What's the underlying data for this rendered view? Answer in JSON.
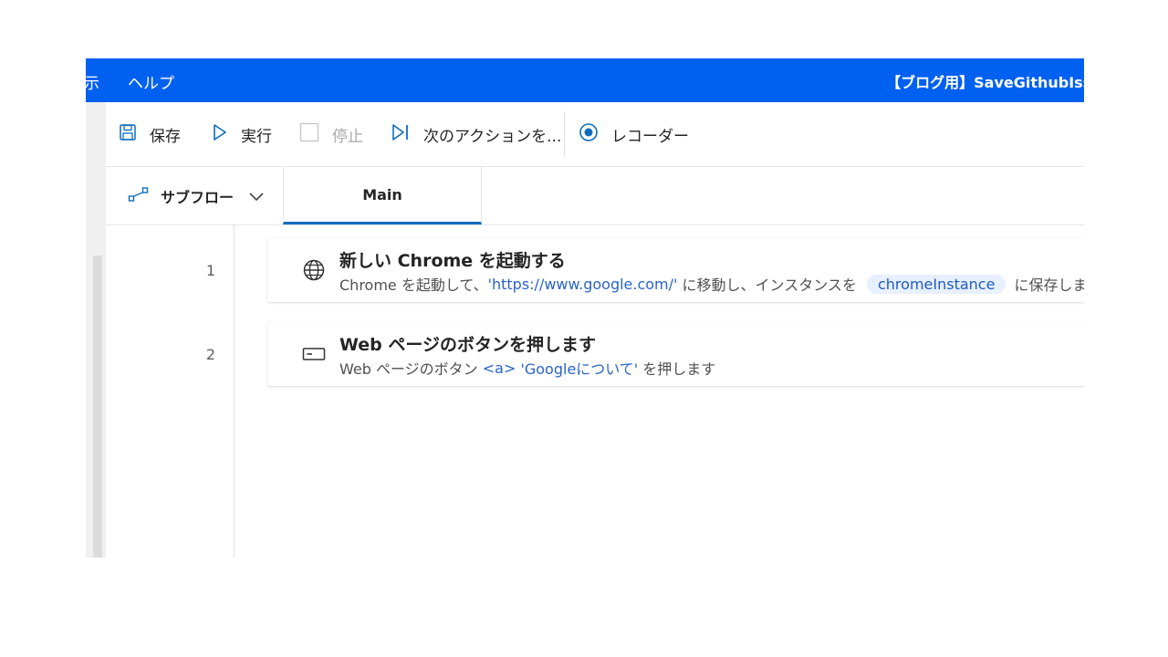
{
  "menubar": {
    "view_label": "示",
    "help_label": "ヘルプ",
    "window_title": "【ブログ用】SaveGithubIssues"
  },
  "toolbar": {
    "save_label": "保存",
    "run_label": "実行",
    "stop_label": "停止",
    "next_action_label": "次のアクションを...",
    "recorder_label": "レコーダー"
  },
  "tabs": {
    "subflow_label": "サブフロー",
    "main_label": "Main"
  },
  "actions": [
    {
      "line": "1",
      "icon": "globe-icon",
      "title": "新しい Chrome を起動する",
      "desc_prefix": "Chrome を起動して、",
      "desc_url": "'https://www.google.com/'",
      "desc_middle": " に移動し、インスタンスを ",
      "desc_var": "chromeInstance",
      "desc_suffix": " に保存します"
    },
    {
      "line": "2",
      "icon": "button-icon",
      "title": "Web ページのボタンを押します",
      "desc_prefix": "Web ページのボタン ",
      "desc_tag": "<a>",
      "desc_element": "'Googleについて'",
      "desc_suffix": " を押します"
    }
  ],
  "colors": {
    "menubar_bg": "#0060f0",
    "accent": "#0f6cbd",
    "literal_text": "#2a63c7",
    "chip_bg": "#e8f0fd"
  }
}
